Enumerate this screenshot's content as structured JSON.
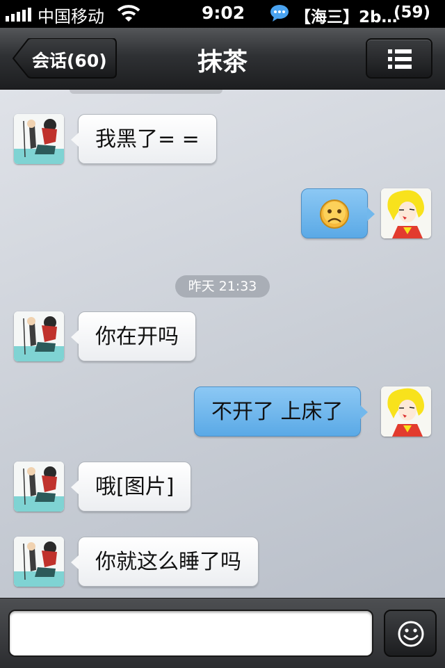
{
  "status_bar": {
    "carrier": "中国移动",
    "time": "9:02",
    "notification": "【海三】2b…",
    "notification_count": "(59)"
  },
  "nav": {
    "back_label": "会话(60)",
    "title": "抹茶"
  },
  "chat": {
    "timestamp": "昨天 21:33",
    "messages": [
      {
        "direction": "in",
        "text": "我黑了= ="
      },
      {
        "direction": "out",
        "emoji": "sad-face-emoji",
        "text": ""
      },
      {
        "direction": "in",
        "text": "你在开吗"
      },
      {
        "direction": "out",
        "text": "不开了 上床了"
      },
      {
        "direction": "in",
        "text": "哦[图片]"
      },
      {
        "direction": "in",
        "text": "你就这么睡了吗"
      }
    ]
  },
  "input": {
    "value": "",
    "placeholder": ""
  },
  "colors": {
    "incoming_bubble": "#ffffff",
    "outgoing_bubble": "#6cb4ec",
    "navbar": "#2f3134"
  },
  "icons": [
    "signal-icon",
    "wifi-icon",
    "chat-bubble-icon",
    "back-arrow",
    "menu-list-icon",
    "smiley-icon",
    "contact-avatar",
    "my-avatar"
  ]
}
